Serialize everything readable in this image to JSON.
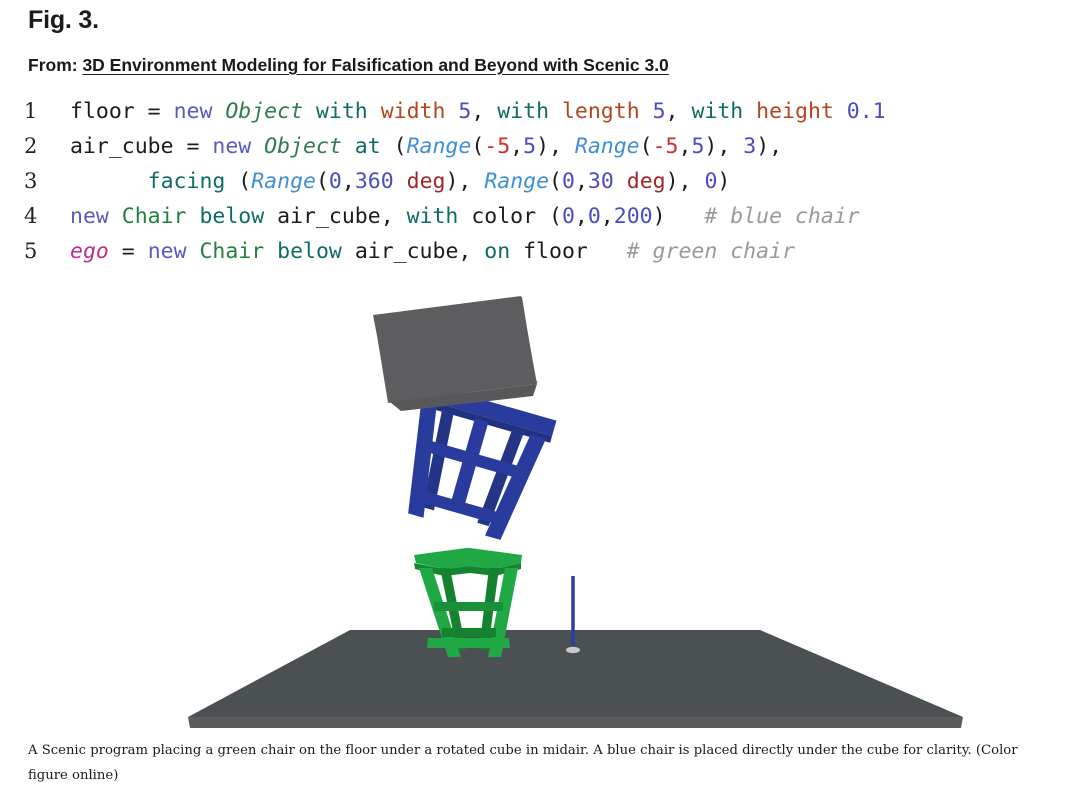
{
  "figure": {
    "label": "Fig. 3.",
    "from_label": "From:",
    "source_title": "3D Environment Modeling for Falsification and Beyond with Scenic 3.0",
    "caption": "A Scenic program placing a green chair on the floor under a rotated cube in midair. A blue chair is placed directly under the cube for clarity. (Color figure online)"
  },
  "code": {
    "language": "scenic",
    "lines": [
      {
        "number": "1",
        "tokens": [
          {
            "t": "floor = ",
            "c": "plain"
          },
          {
            "t": "new ",
            "c": "kw"
          },
          {
            "t": "Object",
            "c": "type"
          },
          {
            "t": " ",
            "c": "plain"
          },
          {
            "t": "with",
            "c": "spec"
          },
          {
            "t": " ",
            "c": "plain"
          },
          {
            "t": "width",
            "c": "prop"
          },
          {
            "t": " ",
            "c": "plain"
          },
          {
            "t": "5",
            "c": "num"
          },
          {
            "t": ", ",
            "c": "plain"
          },
          {
            "t": "with",
            "c": "spec"
          },
          {
            "t": " ",
            "c": "plain"
          },
          {
            "t": "length",
            "c": "prop"
          },
          {
            "t": " ",
            "c": "plain"
          },
          {
            "t": "5",
            "c": "num"
          },
          {
            "t": ", ",
            "c": "plain"
          },
          {
            "t": "with",
            "c": "spec"
          },
          {
            "t": " ",
            "c": "plain"
          },
          {
            "t": "height",
            "c": "prop"
          },
          {
            "t": " ",
            "c": "plain"
          },
          {
            "t": "0.1",
            "c": "num"
          }
        ]
      },
      {
        "number": "2",
        "tokens": [
          {
            "t": "air_cube = ",
            "c": "plain"
          },
          {
            "t": "new ",
            "c": "kw"
          },
          {
            "t": "Object",
            "c": "type"
          },
          {
            "t": " ",
            "c": "plain"
          },
          {
            "t": "at",
            "c": "spec"
          },
          {
            "t": " (",
            "c": "plain"
          },
          {
            "t": "Range",
            "c": "range"
          },
          {
            "t": "(",
            "c": "plain"
          },
          {
            "t": "-5",
            "c": "neg"
          },
          {
            "t": ",",
            "c": "plain"
          },
          {
            "t": "5",
            "c": "num"
          },
          {
            "t": "), ",
            "c": "plain"
          },
          {
            "t": "Range",
            "c": "range"
          },
          {
            "t": "(",
            "c": "plain"
          },
          {
            "t": "-5",
            "c": "neg"
          },
          {
            "t": ",",
            "c": "plain"
          },
          {
            "t": "5",
            "c": "num"
          },
          {
            "t": "), ",
            "c": "plain"
          },
          {
            "t": "3",
            "c": "num"
          },
          {
            "t": "),",
            "c": "plain"
          }
        ]
      },
      {
        "number": "3",
        "tokens": [
          {
            "t": "      ",
            "c": "plain"
          },
          {
            "t": "facing",
            "c": "spec"
          },
          {
            "t": " (",
            "c": "plain"
          },
          {
            "t": "Range",
            "c": "range"
          },
          {
            "t": "(",
            "c": "plain"
          },
          {
            "t": "0",
            "c": "num"
          },
          {
            "t": ",",
            "c": "plain"
          },
          {
            "t": "360",
            "c": "num"
          },
          {
            "t": " ",
            "c": "plain"
          },
          {
            "t": "deg",
            "c": "deg"
          },
          {
            "t": "), ",
            "c": "plain"
          },
          {
            "t": "Range",
            "c": "range"
          },
          {
            "t": "(",
            "c": "plain"
          },
          {
            "t": "0",
            "c": "num"
          },
          {
            "t": ",",
            "c": "plain"
          },
          {
            "t": "30",
            "c": "num"
          },
          {
            "t": " ",
            "c": "plain"
          },
          {
            "t": "deg",
            "c": "deg"
          },
          {
            "t": "), ",
            "c": "plain"
          },
          {
            "t": "0",
            "c": "num"
          },
          {
            "t": ")",
            "c": "plain"
          }
        ]
      },
      {
        "number": "4",
        "tokens": [
          {
            "t": "new ",
            "c": "kw"
          },
          {
            "t": "Chair",
            "c": "class"
          },
          {
            "t": " ",
            "c": "plain"
          },
          {
            "t": "below",
            "c": "spec"
          },
          {
            "t": " air_cube, ",
            "c": "plain"
          },
          {
            "t": "with",
            "c": "spec"
          },
          {
            "t": " color (",
            "c": "plain"
          },
          {
            "t": "0",
            "c": "num"
          },
          {
            "t": ",",
            "c": "plain"
          },
          {
            "t": "0",
            "c": "num"
          },
          {
            "t": ",",
            "c": "plain"
          },
          {
            "t": "200",
            "c": "num"
          },
          {
            "t": ")   ",
            "c": "plain"
          },
          {
            "t": "# blue chair",
            "c": "comment"
          }
        ]
      },
      {
        "number": "5",
        "tokens": [
          {
            "t": "ego",
            "c": "ego"
          },
          {
            "t": " = ",
            "c": "plain"
          },
          {
            "t": "new ",
            "c": "kw"
          },
          {
            "t": "Chair",
            "c": "class"
          },
          {
            "t": " ",
            "c": "plain"
          },
          {
            "t": "below",
            "c": "spec"
          },
          {
            "t": " air_cube, ",
            "c": "plain"
          },
          {
            "t": "on",
            "c": "spec"
          },
          {
            "t": " floor   ",
            "c": "plain"
          },
          {
            "t": "# green chair",
            "c": "comment"
          }
        ]
      }
    ]
  },
  "scene": {
    "description": "3D render of a rotated gray cube in midair above a blue chair, with a green chair standing on a gray floor plane and a blue ego marker pin",
    "objects": [
      {
        "name": "air_cube",
        "label": "rotated gray cube in midair",
        "color": "#5a5a5c"
      },
      {
        "name": "blue-chair",
        "label": "blue chair below the cube",
        "color": "#28389c"
      },
      {
        "name": "green-chair",
        "label": "green chair on the floor",
        "color": "#1a9e3c"
      },
      {
        "name": "floor",
        "label": "gray floor plane",
        "color": "#4b5052"
      },
      {
        "name": "ego-marker",
        "label": "ego position marker pin",
        "color": "#2b3f9e"
      }
    ],
    "colors": {
      "cube_face": "#5a5a5c",
      "cube_top": "#6b6b6d",
      "blue_chair": "#28389c",
      "blue_chair_dark": "#21307f",
      "green_chair": "#1a9e3c",
      "green_chair_dark": "#14822f",
      "floor_top": "#4b5052",
      "floor_edge": "#5a5c5e",
      "marker_line": "#2b3f9e",
      "marker_base": "#c9c9c9",
      "background": "#ffffff"
    }
  }
}
